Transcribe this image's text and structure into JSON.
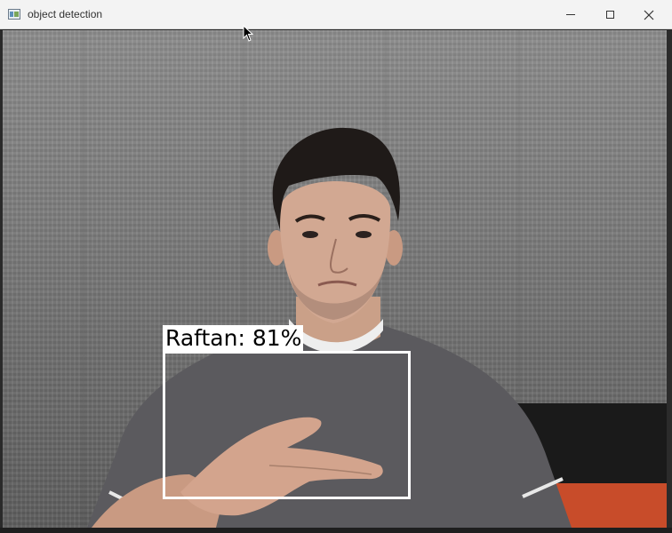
{
  "window": {
    "title": "object detection",
    "controls": {
      "minimize": "minimize-icon",
      "maximize": "maximize-icon",
      "close": "close-icon"
    }
  },
  "detection": {
    "label": "Raftan: 81%",
    "class_name": "Raftan",
    "confidence": 0.81,
    "box_color": "#ffffff"
  },
  "colors": {
    "titlebar": "#f3f3f3",
    "wall": "#7d7d7d",
    "shirt": "#5a5a5e",
    "chair_accent": "#c84c2a"
  }
}
